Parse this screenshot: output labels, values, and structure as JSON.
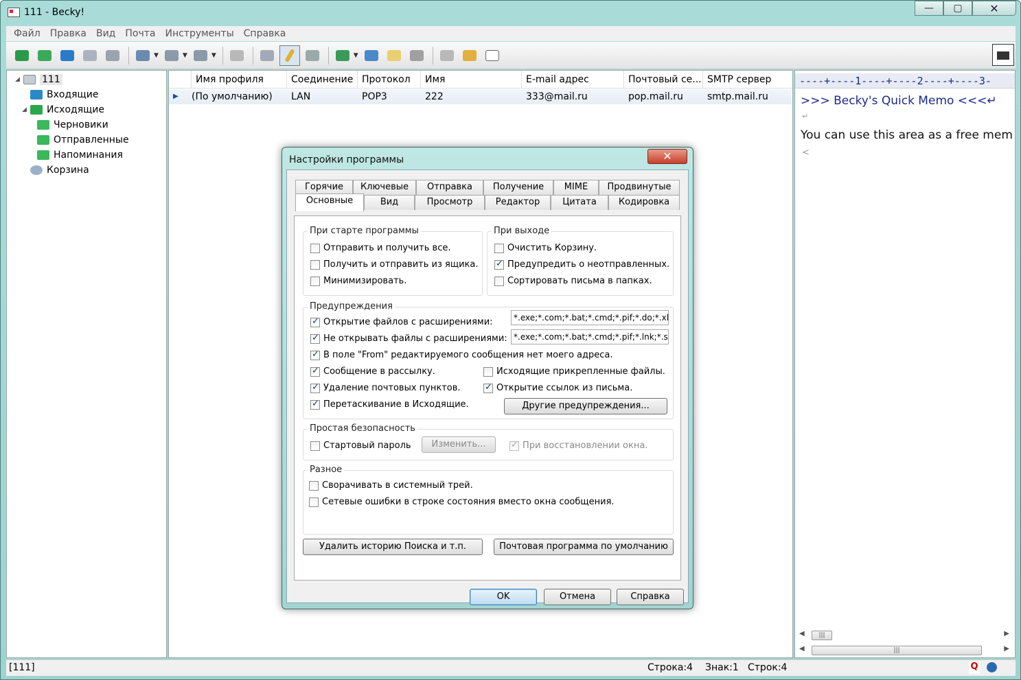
{
  "window": {
    "title": "111 - Becky!",
    "minimize": "—",
    "maximize": "▢",
    "close": "✕"
  },
  "menu": [
    "Файл",
    "Правка",
    "Вид",
    "Почта",
    "Инструменты",
    "Справка"
  ],
  "tree": {
    "root": "111",
    "items": [
      "Входящие",
      "Исходящие",
      "Черновики",
      "Отправленные",
      "Напоминания",
      "Корзина"
    ]
  },
  "profiles": {
    "headers": [
      "Имя профиля",
      "Соединение",
      "Протокол",
      "Имя",
      "E-mail адрес",
      "Почтовый се...",
      "SMTP сервер"
    ],
    "row": [
      "(По умолчанию)",
      "LAN",
      "POP3",
      "222",
      "333@mail.ru",
      "pop.mail.ru",
      "smtp.mail.ru"
    ]
  },
  "memo": {
    "ruler": "----+----1----+----2----+----3-",
    "line1": ">>> Becky's Quick Memo <<<↵",
    "line2": "You can use this area as a free memo",
    "newline": "↵",
    "end": "<"
  },
  "status": {
    "left": "[111]",
    "line": "Строка:4",
    "char": "Знак:1",
    "row": "Строк:4"
  },
  "dialog": {
    "title": "Настройки программы",
    "close": "✕",
    "tabs_row1": [
      "Горячие",
      "Ключевые",
      "Отправка",
      "Получение",
      "MIME",
      "Продвинутые"
    ],
    "tabs_row2": [
      "Основные",
      "Вид",
      "Просмотр",
      "Редактор",
      "Цитата",
      "Кодировка"
    ],
    "startup": {
      "title": "При старте программы",
      "items": [
        {
          "label": "Отправить и получить все.",
          "checked": false
        },
        {
          "label": "Получить и отправить из ящика.",
          "checked": false
        },
        {
          "label": "Минимизировать.",
          "checked": false
        }
      ]
    },
    "exit": {
      "title": "При выходе",
      "items": [
        {
          "label": "Очистить Корзину.",
          "checked": false
        },
        {
          "label": "Предупредить о неотправленных.",
          "checked": true
        },
        {
          "label": "Сортировать письма в папках.",
          "checked": false
        }
      ]
    },
    "warnings": {
      "title": "Предупреждения",
      "open_ext": "Открытие файлов с расширениями:",
      "open_ext_value": "*.exe;*.com;*.bat;*.cmd;*.pif;*.do;*.xl;*.re",
      "noopen_ext": "Не открывать файлы с расширениями:",
      "noopen_ext_value": "*.exe;*.com;*.bat;*.cmd;*.pif;*.lnk;*.scr;*",
      "from": "В поле \"From\" редактируемого сообщения нет моего адреса.",
      "mailing": "Сообщение в рассылку.",
      "delete": "Удаление почтовых пунктов.",
      "drag": "Перетаскивание в Исходящие.",
      "attach": "Исходящие прикрепленные файлы.",
      "links": "Открытие ссылок из письма.",
      "other_btn": "Другие предупреждения..."
    },
    "security": {
      "title": "Простая безопасность",
      "startup_pwd": "Стартовый пароль",
      "change_btn": "Изменить...",
      "restore": "При восстановлении окна."
    },
    "misc": {
      "title": "Разное",
      "tray": "Сворачивать в системный трей.",
      "neterr": "Сетевые ошибки в строке состояния вместо окна сообщения."
    },
    "clear_history_btn": "Удалить историю Поиска и т.п.",
    "default_mail_btn": "Почтовая программа по умолчанию",
    "ok": "OK",
    "cancel": "Отмена",
    "help": "Справка"
  }
}
